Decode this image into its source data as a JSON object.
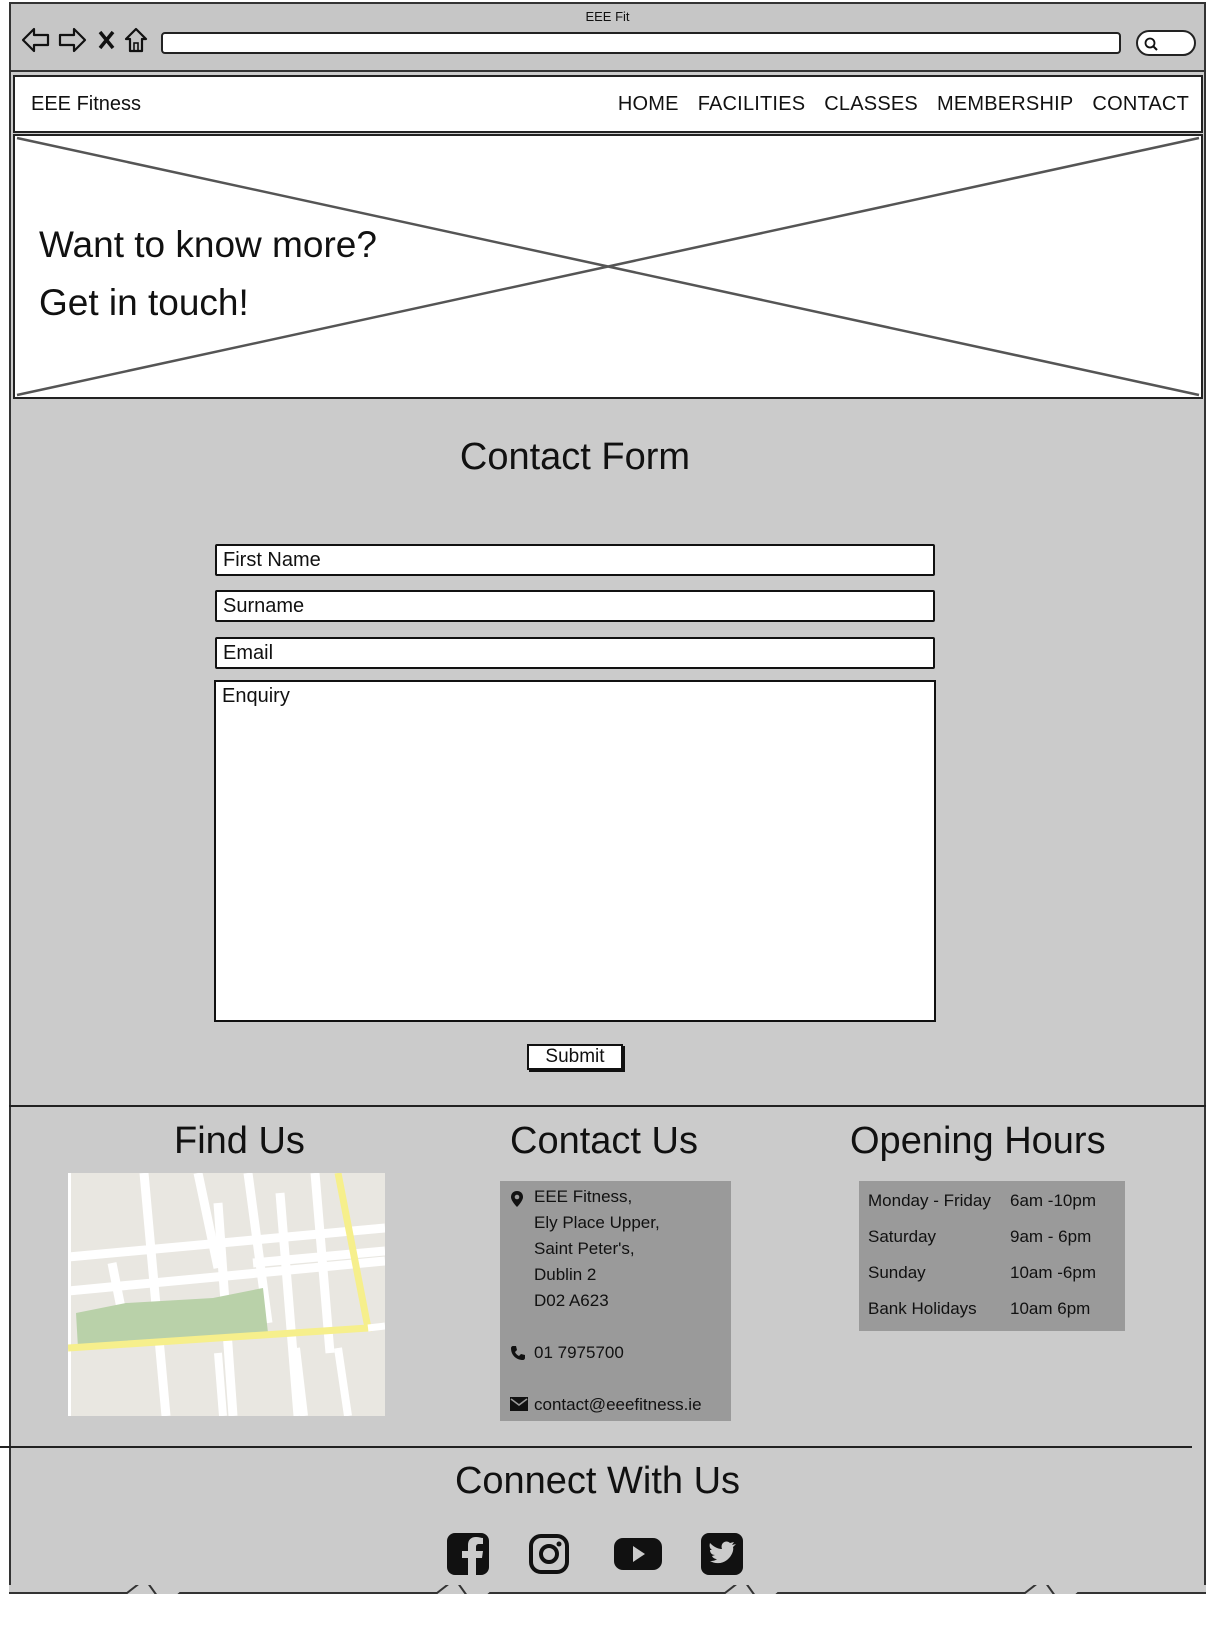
{
  "browser": {
    "title": "EEE Fit"
  },
  "header": {
    "brand": "EEE Fitness",
    "nav": [
      "HOME",
      "FACILITIES",
      "CLASSES",
      "MEMBERSHIP",
      "CONTACT"
    ]
  },
  "hero": {
    "line1": "Want to know more?",
    "line2": "Get in touch!"
  },
  "form": {
    "title": "Contact Form",
    "first_name": "First Name",
    "surname": "Surname",
    "email": "Email",
    "enquiry": "Enquiry",
    "submit": "Submit"
  },
  "find_us": {
    "title": "Find Us"
  },
  "contact_us": {
    "title": "Contact Us",
    "address": [
      "EEE Fitness,",
      "Ely Place Upper,",
      "Saint Peter's,",
      "Dublin 2",
      "D02 A623"
    ],
    "phone": "01 7975700",
    "email": "contact@eeefitness.ie"
  },
  "opening_hours": {
    "title": "Opening Hours",
    "rows": [
      {
        "day": "Monday - Friday",
        "time": "6am -10pm"
      },
      {
        "day": "Saturday",
        "time": "9am - 6pm"
      },
      {
        "day": "Sunday",
        "time": "10am -6pm"
      },
      {
        "day": "Bank Holidays",
        "time": "10am 6pm"
      }
    ]
  },
  "connect": {
    "title": "Connect With Us",
    "icons": [
      "facebook-icon",
      "instagram-icon",
      "youtube-icon",
      "twitter-icon"
    ]
  },
  "colors": {
    "page_bg": "#cbcbcb",
    "box_bg": "#9a9a9a",
    "map_green": "#b9d1a9",
    "map_yellow": "#f6ef8c"
  }
}
